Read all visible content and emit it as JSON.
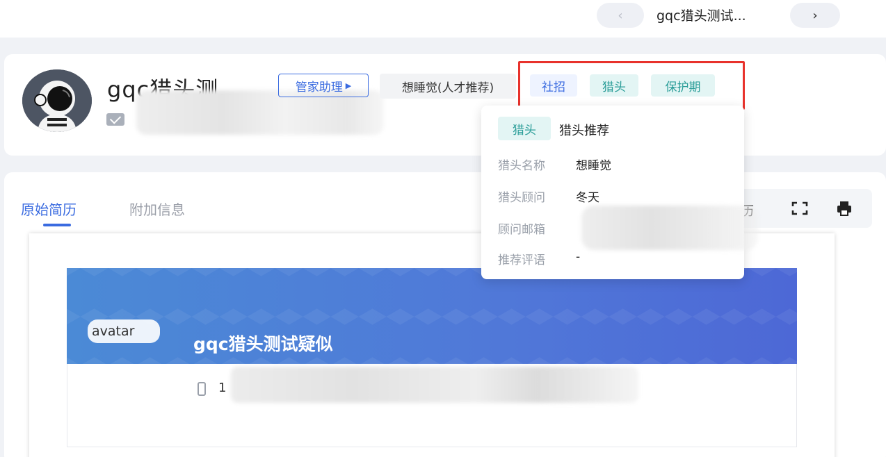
{
  "nav": {
    "prev_icon": "chevron-left-icon",
    "title": "gqc猎头测试...",
    "next_icon": "chevron-right-icon"
  },
  "header": {
    "candidate_name": "gqc猎头测...",
    "butler_label": "管家助理",
    "source_label": "想睡觉(人才推荐)",
    "tags": {
      "social": "社招",
      "hunter": "猎头",
      "protection": "保护期"
    }
  },
  "popover": {
    "tag": "猎头",
    "type": "猎头推荐",
    "rows": [
      {
        "label": "猎头名称",
        "value": "想睡觉"
      },
      {
        "label": "猎头顾问",
        "value": "冬天"
      },
      {
        "label": "顾问邮箱",
        "value": ""
      },
      {
        "label": "推荐评语",
        "value": "-"
      }
    ]
  },
  "tabs": {
    "original": "原始简历",
    "extra": "附加信息"
  },
  "toolbar": {
    "label": "历",
    "fullscreen_icon": "fullscreen-icon",
    "print_icon": "print-icon"
  },
  "resume": {
    "avatar_alt": "avatar",
    "name": "gqc猎头测试疑似",
    "phone_prefix": "1"
  },
  "colors": {
    "accent": "#3a6be0",
    "teal": "#2a9d98",
    "highlight": "#e8322c",
    "banner": "#4f86d8"
  }
}
